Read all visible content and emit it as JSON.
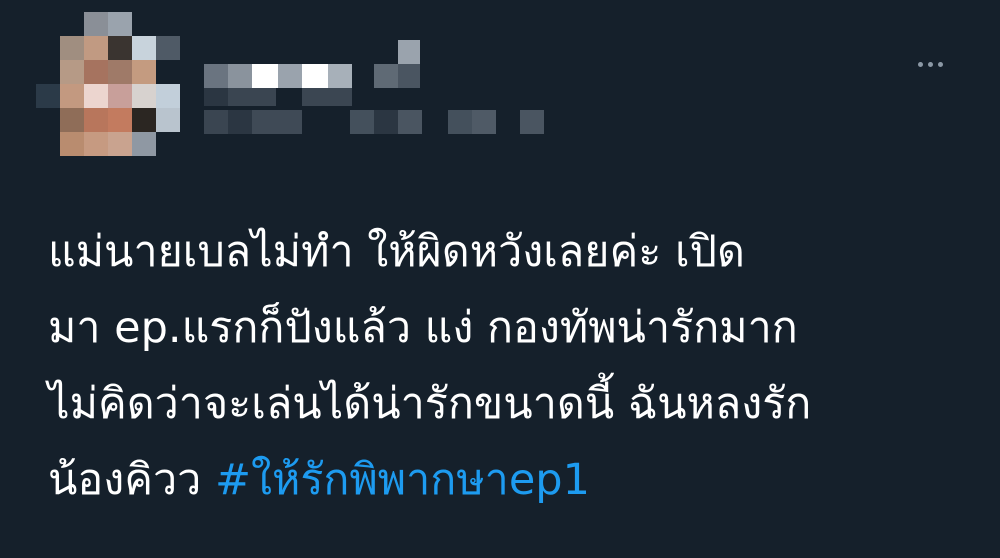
{
  "tweet": {
    "author": {
      "display_name": "",
      "handle": "",
      "avatar_redacted": true,
      "name_redacted": true
    },
    "menu_icon": "more-horizontal-icon",
    "text_lines": [
      "แม่นายเบลไม่ทำ ให้ผิดหวังเลยค่ะ เปิด",
      "มา ep.แรกก็ปังแล้ว แง่ กองทัพน่ารักมาก",
      "ไม่คิดว่าจะเล่นได้น่ารักขนาดนี้ ฉันหลงรัก"
    ],
    "last_line_text": "น้องคิวว ",
    "hashtag": "#ให้รักพิพากษาep1",
    "colors": {
      "background": "#15202b",
      "text": "#ffffff",
      "link": "#1d9bf0",
      "muted": "#8b98a5"
    }
  }
}
